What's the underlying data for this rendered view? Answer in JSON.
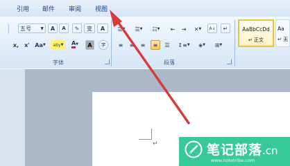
{
  "tabs": [
    "引用",
    "邮件",
    "审阅",
    "视图"
  ],
  "font_group": {
    "size_value": "五号",
    "grow_label": "A",
    "shrink_label": "A",
    "phonetic_label": "变",
    "enclose_label": "A",
    "subscript_label": "x,",
    "superscript_label": "x'",
    "case_label": "Aa",
    "highlight_label": "aby",
    "fontcolor_label": "A",
    "shading_label": "A",
    "charborder_label": "字",
    "label": "字体"
  },
  "paragraph_group": {
    "label": "段落",
    "sort_label": "A↓",
    "marks_label": "↵"
  },
  "styles": {
    "sample": "AaBbCcDd",
    "name": "正文",
    "sample_partial": "Aa",
    "name_partial": "无"
  },
  "document": {
    "paragraph_mark": "↵"
  },
  "watermark": {
    "title": "笔记部落",
    "suffix": ".cn",
    "url": "www.notetribe.com"
  },
  "colors": {
    "accent_arrow": "#d83a3a",
    "watermark_green": "#26c490",
    "ribbon_text": "#15428b"
  }
}
